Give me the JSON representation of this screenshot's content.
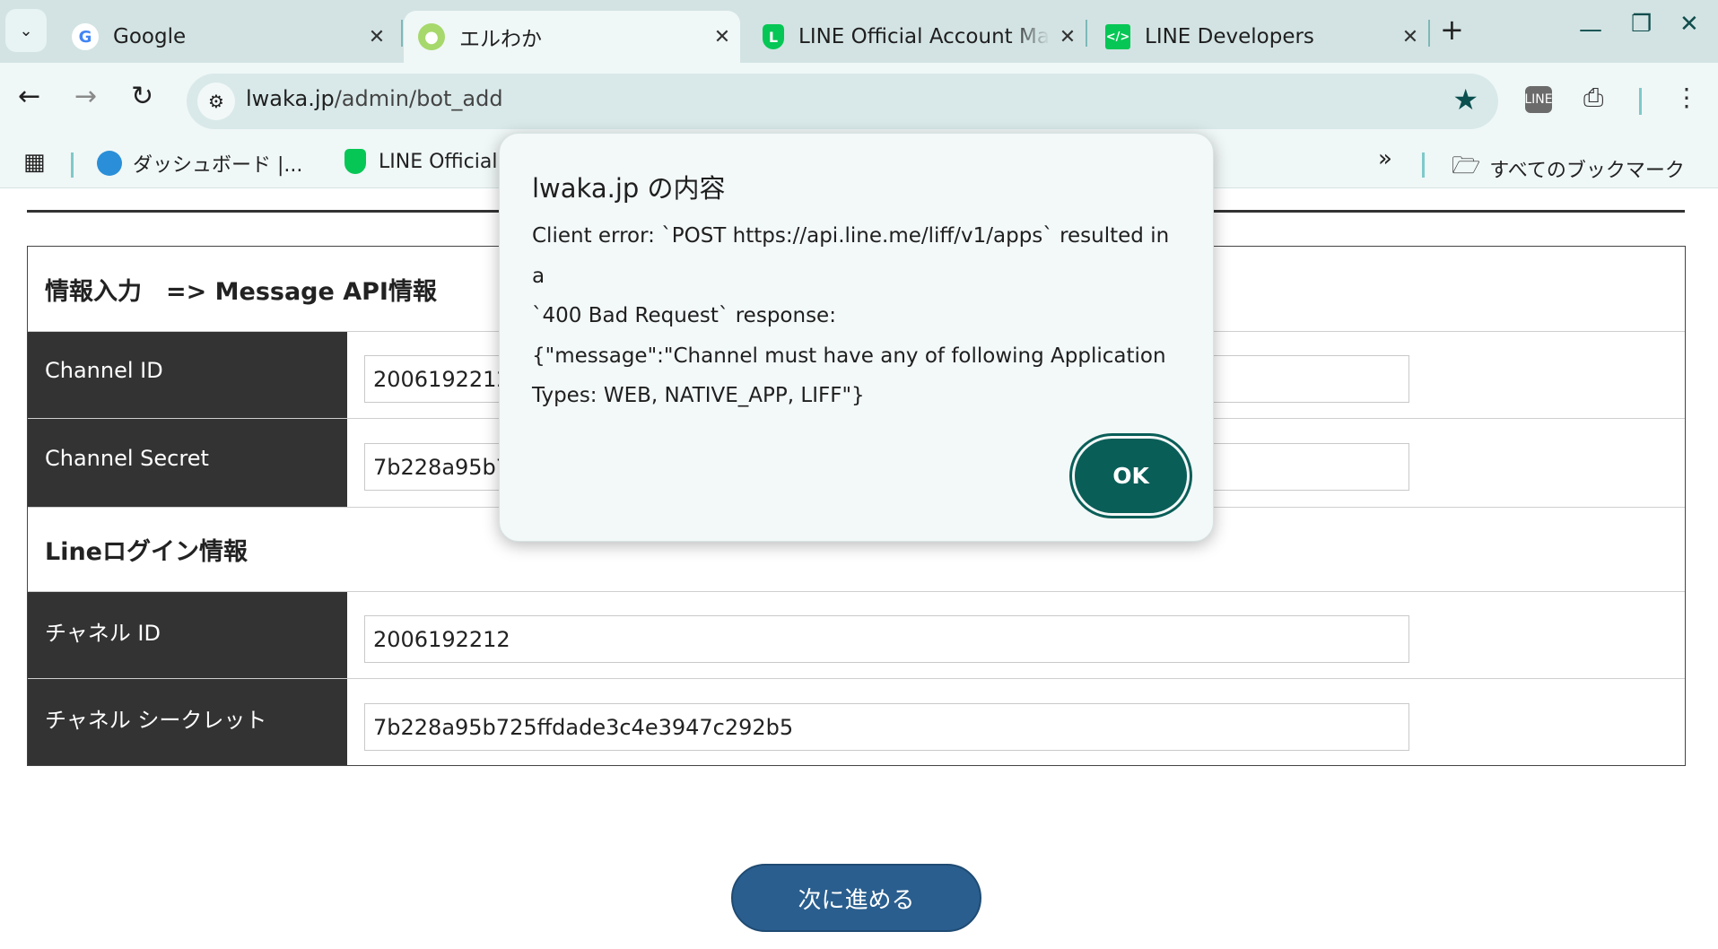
{
  "browser": {
    "tabs": [
      {
        "title": "Google",
        "favicon": "google-favicon",
        "active": false
      },
      {
        "title": "エルわか",
        "favicon": "elwaka-favicon",
        "active": true
      },
      {
        "title": "LINE Official Account Ma",
        "favicon": "line-shield-favicon",
        "active": false
      },
      {
        "title": "LINE Developers",
        "favicon": "line-developers-favicon",
        "active": false
      }
    ],
    "url_host": "lwaka.jp",
    "url_path": "/admin/bot_add",
    "bookmarks": [
      {
        "label": "ダッシュボード |...",
        "icon": "dashboard-favicon"
      },
      {
        "label": "LINE Official",
        "icon": "line-shield-favicon"
      }
    ],
    "all_bookmarks_label": "すべてのブックマーク"
  },
  "page": {
    "section1_title": "情報入力　=> Message API情報",
    "section2_title": "Lineログイン情報",
    "rows": [
      {
        "label": "Channel ID",
        "value": "2006192212"
      },
      {
        "label": "Channel Secret",
        "value": "7b228a95b7"
      },
      {
        "label": "チャネル ID",
        "value": "2006192212"
      },
      {
        "label": "チャネル シークレット",
        "value": "7b228a95b725ffdade3c4e3947c292b5"
      }
    ],
    "next_button": "次に進める"
  },
  "dialog": {
    "title": "lwaka.jp の内容",
    "message": "Client error: `POST https://api.line.me/liff/v1/apps` resulted in a\n`400 Bad Request` response:\n{\"message\":\"Channel must have any of following Application\nTypes: WEB, NATIVE_APP, LIFF\"}",
    "ok_label": "OK"
  },
  "colors": {
    "tabstrip": "#d3e3e3",
    "toolbar": "#f0f7f7",
    "label_bg": "#333333",
    "next_button": "#2a5e8e",
    "ok_button": "#0a5e58",
    "line_green": "#06c755"
  }
}
